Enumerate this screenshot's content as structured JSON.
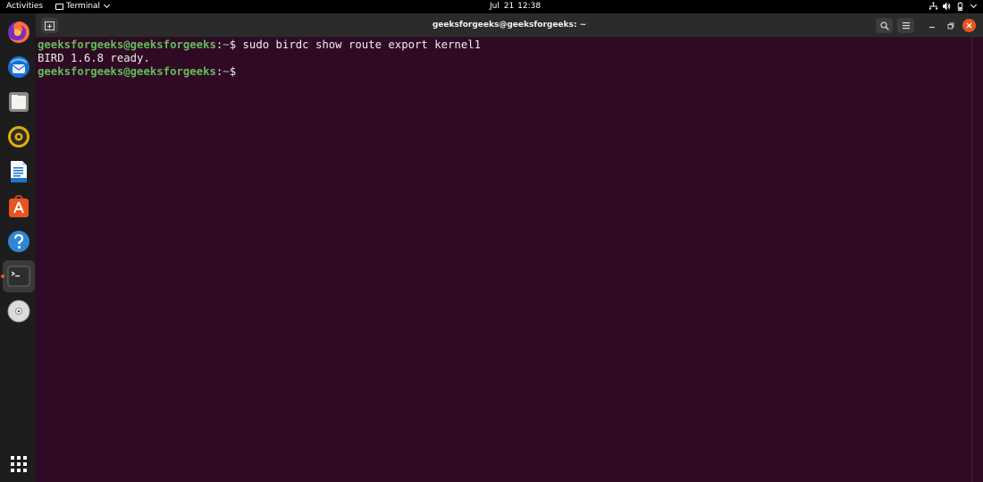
{
  "top_bar": {
    "activities": "Activities",
    "app_name": "Terminal",
    "date": "Jul 21",
    "time": "12:38"
  },
  "dock": {
    "items": [
      {
        "name": "firefox",
        "icon": "firefox-icon"
      },
      {
        "name": "thunderbird",
        "icon": "thunderbird-icon"
      },
      {
        "name": "files",
        "icon": "files-icon"
      },
      {
        "name": "rhythmbox",
        "icon": "rhythmbox-icon"
      },
      {
        "name": "libreoffice-writer",
        "icon": "writer-icon"
      },
      {
        "name": "ubuntu-software",
        "icon": "software-icon"
      },
      {
        "name": "help",
        "icon": "help-icon"
      },
      {
        "name": "terminal",
        "icon": "terminal-icon",
        "active": true
      },
      {
        "name": "dvd",
        "icon": "disc-icon"
      }
    ],
    "show_apps_icon": "app-grid-icon"
  },
  "window": {
    "title": "geeksforgeeks@geeksforgeeks: ~",
    "accent": "#e95420"
  },
  "terminal": {
    "lines": [
      {
        "user": "geeksforgeeks@geeksforgeeks",
        "sep": ":",
        "path": "~",
        "prompt": "$ ",
        "cmd": "sudo birdc show route export kernel1"
      },
      {
        "output": "BIRD 1.6.8 ready."
      },
      {
        "user": "geeksforgeeks@geeksforgeeks",
        "sep": ":",
        "path": "~",
        "prompt": "$ ",
        "cmd": ""
      }
    ],
    "bg": "#300a24",
    "prompt_user_color": "#5fbf56",
    "prompt_path_color": "#6e95d6"
  }
}
